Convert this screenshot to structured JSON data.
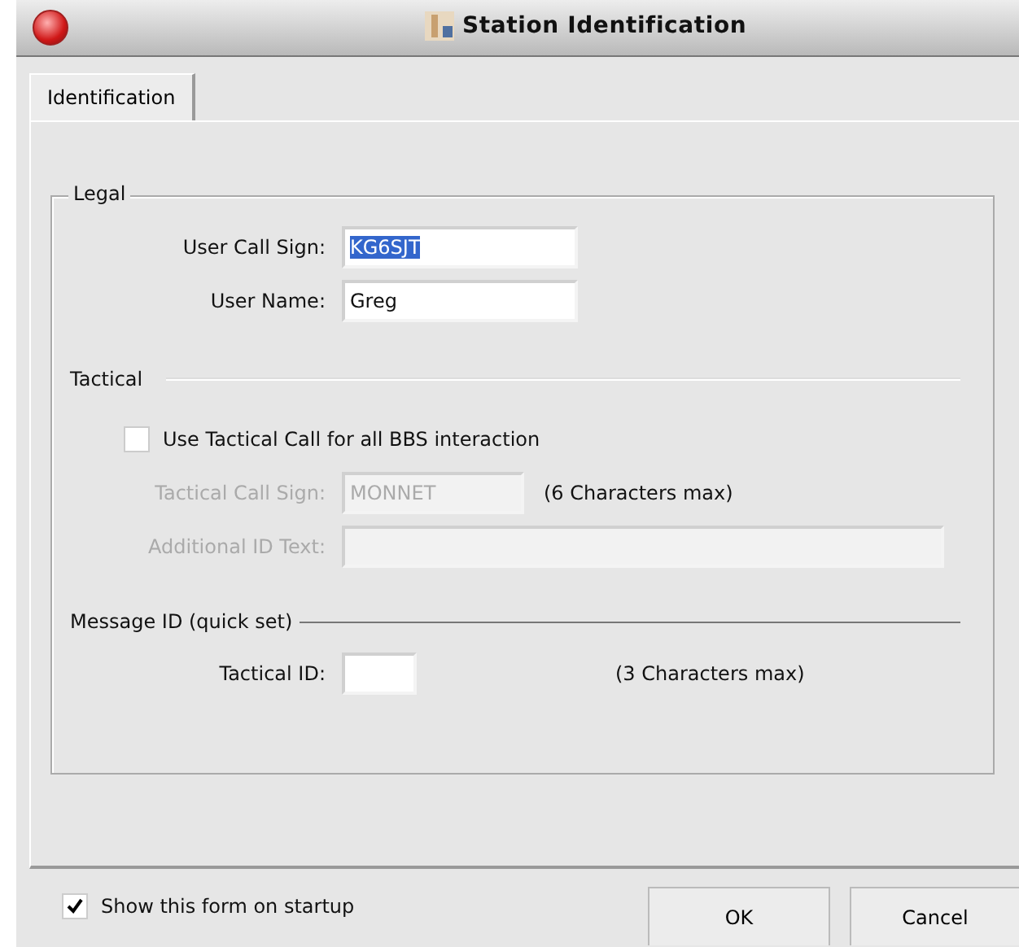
{
  "window": {
    "title": "Station Identification"
  },
  "tabs": [
    {
      "label": "Identification",
      "selected": true
    }
  ],
  "legal": {
    "title": "Legal",
    "fields": [
      {
        "label": "User Call Sign:",
        "value": "KG6SJT",
        "selected_text": true,
        "disabled": false
      },
      {
        "label": "User Name:",
        "value": "Greg",
        "selected_text": false,
        "disabled": false
      }
    ]
  },
  "tactical": {
    "title": "Tactical",
    "checkbox": {
      "label": "Use Tactical Call for all BBS interaction",
      "checked": false
    },
    "fields": [
      {
        "label": "Tactical Call Sign:",
        "value": "MONNET",
        "disabled": true,
        "note": "(6 Characters max)"
      },
      {
        "label": "Additional ID Text:",
        "disabled": true
      }
    ]
  },
  "message_id": {
    "title": "Message ID (quick set)",
    "fields": [
      {
        "label": "Tactical ID:",
        "disabled": false,
        "note": "(3 Characters max)"
      }
    ]
  },
  "footer": {
    "checkbox": {
      "label": "Show this form on startup",
      "checked": true
    },
    "buttons": [
      "OK",
      "Cancel"
    ]
  }
}
